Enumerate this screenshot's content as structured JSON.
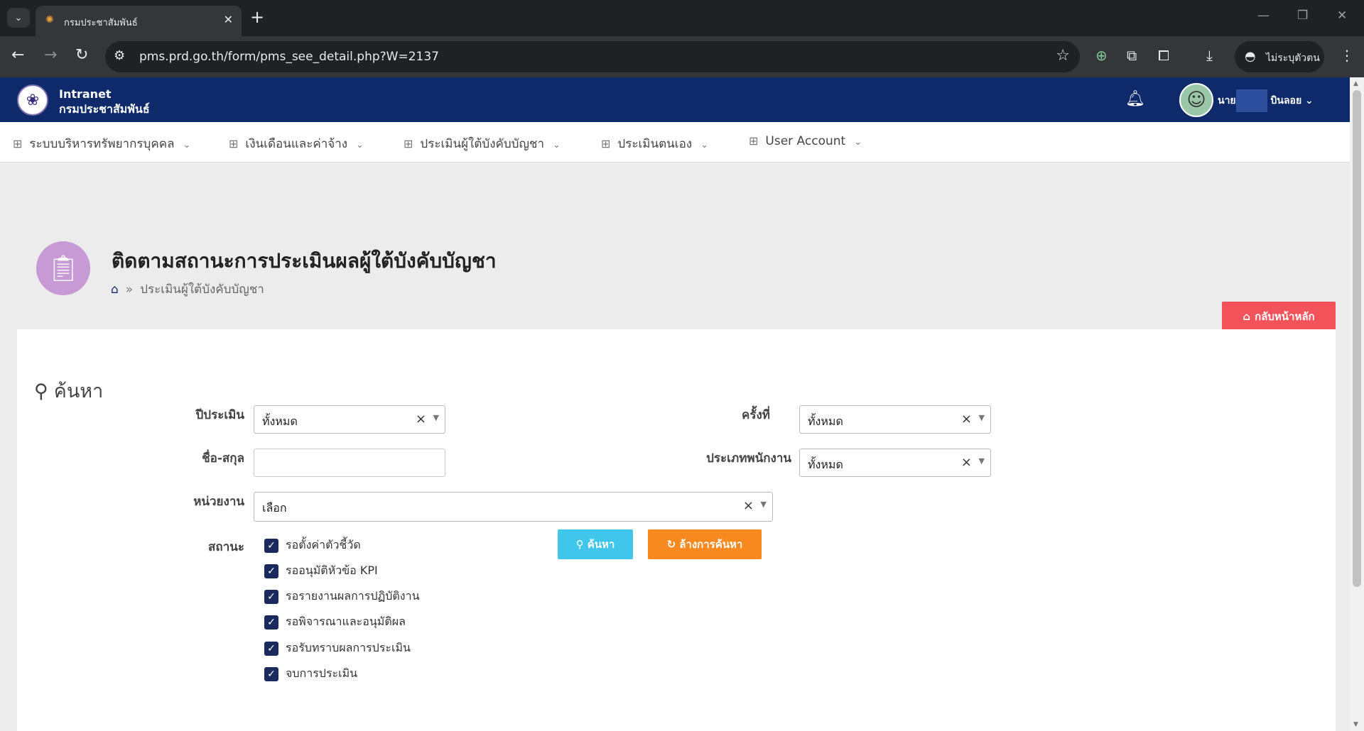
{
  "browser": {
    "tab_title": "กรมประชาสัมพันธ์",
    "url": "pms.prd.go.th/form/pms_see_detail.php?W=2137",
    "profile_label": "ไม่ระบุตัวตน"
  },
  "header": {
    "brand_line1": "Intranet",
    "brand_line2": "กรมประชาสัมพันธ์",
    "user_name_prefix": "นาย",
    "user_name_suffix": "บินลอย"
  },
  "menu": {
    "items": [
      {
        "label": "ระบบบริหารทรัพยากรบุคคล"
      },
      {
        "label": "เงินเดือนและค่าจ้าง"
      },
      {
        "label": "ประเมินผู้ใต้บังคับบัญชา"
      },
      {
        "label": "ประเมินตนเอง"
      },
      {
        "label": "User Account"
      }
    ]
  },
  "page": {
    "title": "ติดตามสถานะการประเมินผลผู้ใต้บังคับบัญชา",
    "breadcrumb": "ประเมินผู้ใต้บังคับบัญชา",
    "back_button": "กลับหน้าหลัก"
  },
  "search": {
    "heading": "ค้นหา",
    "year_label": "ปีประเมิน",
    "year_value": "ทั้งหมด",
    "round_label": "ครั้งที่",
    "round_value": "ทั้งหมด",
    "name_label": "ชื่อ-สกุล",
    "name_value": "",
    "emptype_label": "ประเภทพนักงาน",
    "emptype_value": "ทั้งหมด",
    "unit_label": "หน่วยงาน",
    "unit_value": "เลือก",
    "status_label": "สถานะ",
    "statuses": [
      {
        "label": "รอตั้งค่าตัวชี้วัด",
        "checked": true
      },
      {
        "label": "รออนุมัติหัวข้อ KPI",
        "checked": true
      },
      {
        "label": "รอรายงานผลการปฏิบัติงาน",
        "checked": true
      },
      {
        "label": "รอพิจารณาและอนุมัติผล",
        "checked": true
      },
      {
        "label": "รอรับทราบผลการประเมิน",
        "checked": true
      },
      {
        "label": "จบการประเมิน",
        "checked": true
      }
    ],
    "search_button": "ค้นหา",
    "clear_button": "ล้างการค้นหา"
  }
}
